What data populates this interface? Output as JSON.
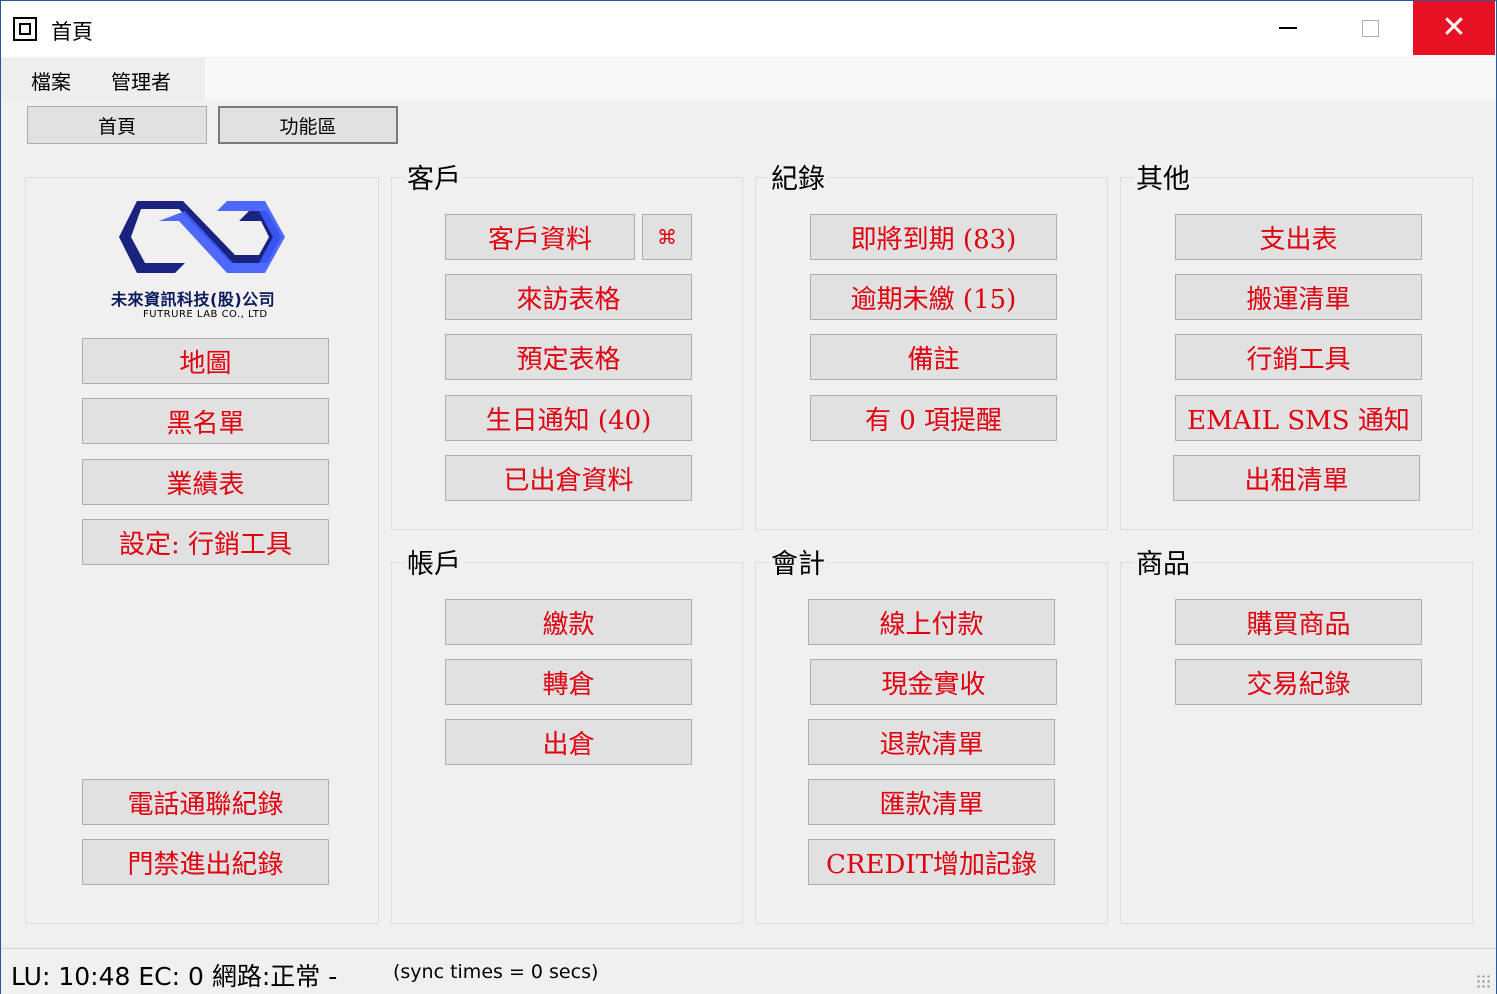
{
  "window": {
    "title": "首頁"
  },
  "menu": [
    "檔案",
    "管理者"
  ],
  "nav": [
    "首頁",
    "功能區"
  ],
  "logo": {
    "name": "未來資訊科技(股)公司",
    "sub": "FUTRURE LAB CO., LTD"
  },
  "left_panel": {
    "top_buttons": [
      "地圖",
      "黑名單",
      "業績表",
      "設定: 行銷工具"
    ],
    "bottom_buttons": [
      "電話通聯紀錄",
      "門禁進出紀錄"
    ]
  },
  "groups": {
    "customer": {
      "title": "客戶",
      "buttons": [
        "客戶資料",
        "來訪表格",
        "預定表格",
        "生日通知 (40)",
        "已出倉資料"
      ],
      "extra_icon": "⌘"
    },
    "records": {
      "title": "紀錄",
      "buttons": [
        "即將到期 (83)",
        "逾期未繳 (15)",
        "備註",
        "有 0 項提醒"
      ]
    },
    "other": {
      "title": "其他",
      "buttons": [
        "支出表",
        "搬運清單",
        "行銷工具",
        "EMAIL SMS 通知",
        "出租清單"
      ]
    },
    "account": {
      "title": "帳戶",
      "buttons": [
        "繳款",
        "轉倉",
        "出倉"
      ]
    },
    "accounting": {
      "title": "會計",
      "buttons": [
        "線上付款",
        "現金實收",
        "退款清單",
        "匯款清單",
        "CREDIT增加記錄"
      ]
    },
    "products": {
      "title": "商品",
      "buttons": [
        "購買商品",
        "交易紀錄"
      ]
    }
  },
  "status": {
    "main": "LU: 10:48   EC: 0   網路:正常   -",
    "sync": "(sync times = 0 secs)"
  },
  "colors": {
    "accent_text": "#e0000f",
    "close_button": "#e81123",
    "logo_blue": "#2f3fd6"
  }
}
